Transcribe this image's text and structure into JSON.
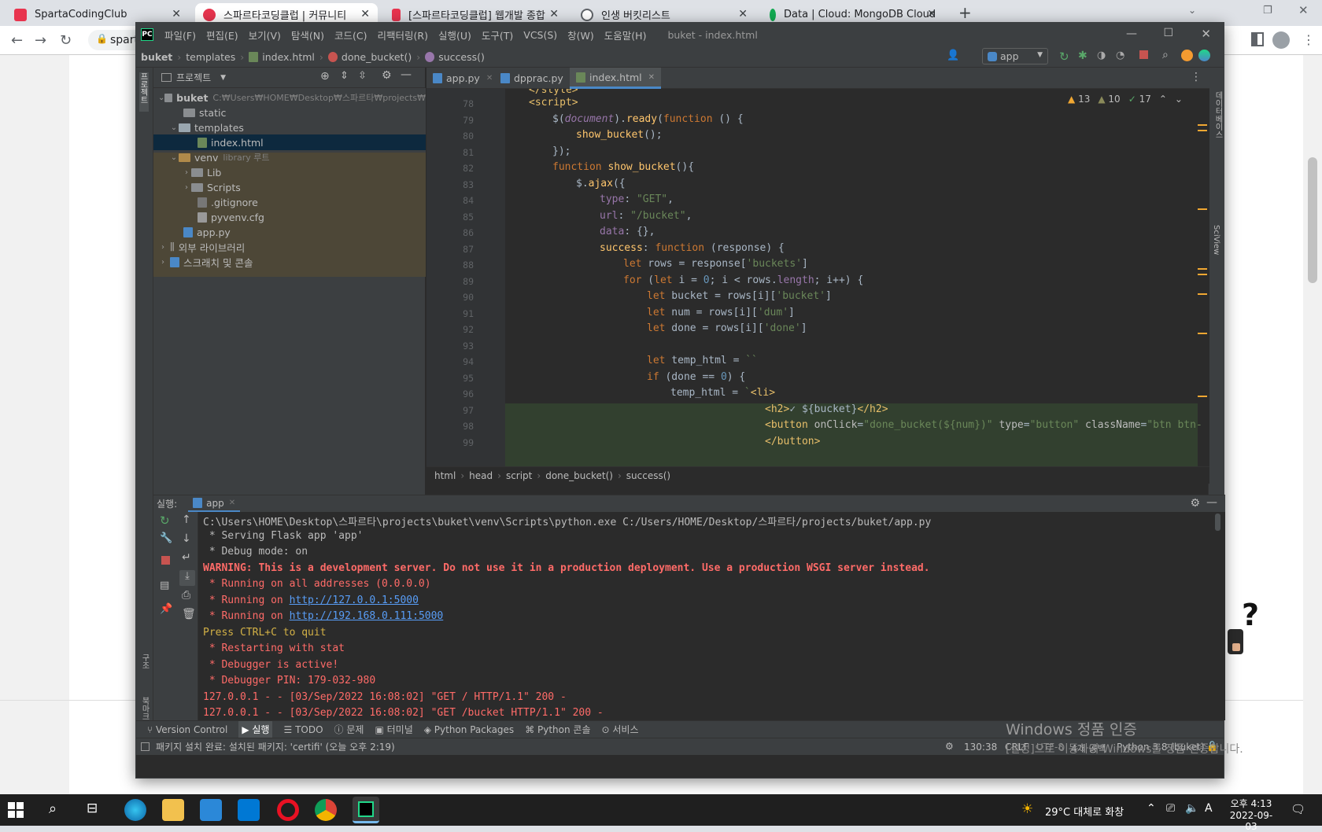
{
  "chrome": {
    "tabs": [
      {
        "label": "SpartaCodingClub",
        "color": "#e8344e"
      },
      {
        "label": "스파르타코딩클럽 | 커뮤니티",
        "color": "#e8344e"
      },
      {
        "label": "[스파르타코딩클럽] 웹개발 종합",
        "color": "#e8344e"
      },
      {
        "label": "인생 버킷리스트",
        "color": "#5f6368"
      },
      {
        "label": "Data | Cloud: MongoDB Cloud",
        "color": "#13aa52"
      }
    ],
    "address_partial": "spart"
  },
  "ide": {
    "menu": [
      "파일(F)",
      "편집(E)",
      "보기(V)",
      "탐색(N)",
      "코드(C)",
      "리팩터링(R)",
      "실행(U)",
      "도구(T)",
      "VCS(S)",
      "창(W)",
      "도움말(H)"
    ],
    "title": "buket - index.html",
    "breadcrumb": [
      "buket",
      "templates",
      "index.html",
      "done_bucket()",
      "success()"
    ],
    "run_config": "app",
    "project_header": "프로젝트",
    "left_strip_label": "프로젝트",
    "tree": [
      {
        "label": "buket",
        "hint": "C:₩Users₩HOME₩Desktop₩스파르타₩projects₩"
      },
      {
        "label": "static"
      },
      {
        "label": "templates"
      },
      {
        "label": "index.html"
      },
      {
        "label": "venv",
        "hint": "library 루트"
      },
      {
        "label": "Lib"
      },
      {
        "label": "Scripts"
      },
      {
        "label": ".gitignore"
      },
      {
        "label": "pyvenv.cfg"
      },
      {
        "label": "app.py"
      },
      {
        "label": "외부 라이브러리"
      },
      {
        "label": "스크래치 및 콘솔"
      }
    ],
    "editor_tabs": [
      "app.py",
      "dpprac.py",
      "index.html"
    ],
    "inspections": {
      "warnings": "13",
      "weak_warnings": "10",
      "ok": "17"
    },
    "line_numbers": [
      "78",
      "79",
      "80",
      "81",
      "82",
      "83",
      "84",
      "85",
      "86",
      "87",
      "88",
      "89",
      "90",
      "91",
      "92",
      "93",
      "94",
      "95",
      "96",
      "97",
      "98",
      "99"
    ],
    "code_crumbs": [
      "html",
      "head",
      "script",
      "done_bucket()",
      "success()"
    ],
    "run_label": "실행:",
    "run_tab": "app",
    "console": [
      {
        "text": "C:\\Users\\HOME\\Desktop\\스파르타\\projects\\buket\\venv\\Scripts\\python.exe C:/Users/HOME/Desktop/스파르타/projects/buket/app.py",
        "cls": "wht"
      },
      {
        "text": " * Serving Flask app 'app'",
        "cls": "wht"
      },
      {
        "text": " * Debug mode: on",
        "cls": "wht"
      },
      {
        "text": "WARNING: This is a development server. Do not use it in a production deployment. Use a production WSGI server instead.",
        "cls": "red"
      },
      {
        "text": " * Running on all addresses (0.0.0.0)",
        "cls": "red"
      },
      {
        "text": " * Running on ",
        "cls": "red",
        "link": "http://127.0.0.1:5000"
      },
      {
        "text": " * Running on ",
        "cls": "red",
        "link": "http://192.168.0.111:5000"
      },
      {
        "text": "Press CTRL+C to quit",
        "cls": "yel"
      },
      {
        "text": " * Restarting with stat",
        "cls": "red"
      },
      {
        "text": " * Debugger is active!",
        "cls": "red"
      },
      {
        "text": " * Debugger PIN: 179-032-980",
        "cls": "red"
      },
      {
        "text": "127.0.0.1 - - [03/Sep/2022 16:08:02] \"GET / HTTP/1.1\" 200 -",
        "cls": "red"
      },
      {
        "text": "127.0.0.1 - - [03/Sep/2022 16:08:02] \"GET /bucket HTTP/1.1\" 200 -",
        "cls": "red"
      }
    ],
    "bottom_tabs": [
      "Version Control",
      "실행",
      "TODO",
      "문제",
      "터미널",
      "Python Packages",
      "Python 콘솔",
      "서비스"
    ],
    "status_message": "패키지 설치 완료: 설치된 패키지: 'certifi' (오늘 오후 2:19)",
    "status_right": [
      "130:38",
      "CRLF",
      "UTF-8",
      "4개 공백",
      "Python 3.8 (buket)"
    ],
    "side_labels": [
      "데이터베이스",
      "SciView",
      "구조",
      "북마크"
    ]
  },
  "activation": {
    "title": "Windows 정품 인증",
    "sub": "[설정]으로 이동하여 Windows를 정품 인증합니다."
  },
  "taskbar": {
    "weather": "29°C 대체로 화창",
    "time": "오후 4:13",
    "date": "2022-09-03",
    "ime": "A"
  }
}
